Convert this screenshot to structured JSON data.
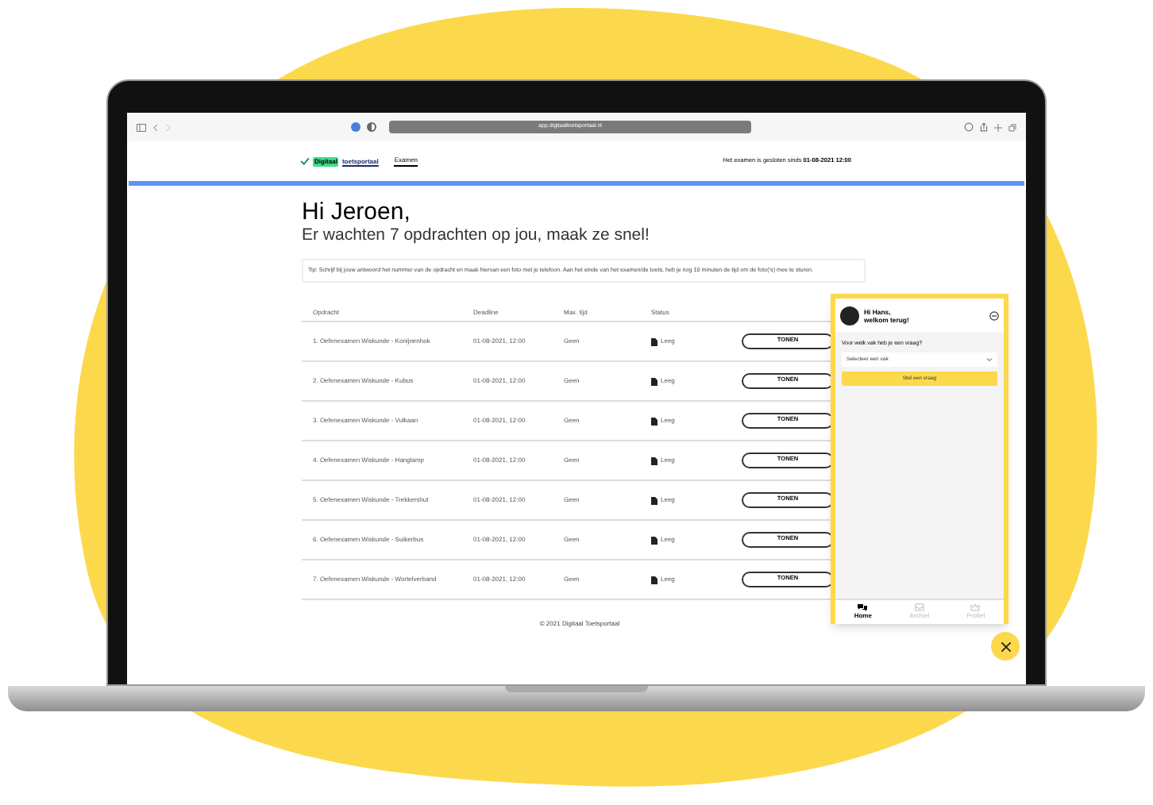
{
  "browser": {
    "url": "app.digitaaltoetsportaal.nl"
  },
  "header": {
    "logo_badge": "Digitaal",
    "logo_text": "toetsportaal",
    "nav": [
      {
        "label": "Examen",
        "selected": true
      }
    ],
    "notice": "Het examen is gesloten sinds",
    "notice_date": "01-08-2021 12:00"
  },
  "greeting": "Hi Jeroen,",
  "subtitle": "Er wachten 7 opdrachten op jou, maak ze snel!",
  "tip": "Tip: Schrijf bij jouw antwoord het nummer van de opdracht en maak hiervan een foto met je telefoon. Aan het einde van het examen/de toets, heb je nog 10 minuten de tijd om de foto('s) mee te sturen.",
  "table": {
    "columns": [
      "Opdracht",
      "Deadline",
      "Max. tijd",
      "Status"
    ],
    "rows": [
      {
        "task": "1. Oefenexamen Wiskunde - Konijnenhok",
        "deadline": "01-08-2021, 12:00",
        "max_time": "Geen",
        "status": "Leeg",
        "action": "TONEN"
      },
      {
        "task": "2. Oefenexamen Wiskunde - Kubus",
        "deadline": "01-08-2021, 12:00",
        "max_time": "Geen",
        "status": "Leeg",
        "action": "TONEN"
      },
      {
        "task": "3. Oefenexamen Wiskunde - Vulkaan",
        "deadline": "01-08-2021, 12:00",
        "max_time": "Geen",
        "status": "Leeg",
        "action": "TONEN"
      },
      {
        "task": "4. Oefenexamen Wiskunde - Hanglamp",
        "deadline": "01-08-2021, 12:00",
        "max_time": "Geen",
        "status": "Leeg",
        "action": "TONEN"
      },
      {
        "task": "5. Oefenexamen Wiskunde - Trekkershut",
        "deadline": "01-08-2021, 12:00",
        "max_time": "Geen",
        "status": "Leeg",
        "action": "TONEN"
      },
      {
        "task": "6. Oefenexamen Wiskunde - Suikerbus",
        "deadline": "01-08-2021, 12:00",
        "max_time": "Geen",
        "status": "Leeg",
        "action": "TONEN"
      },
      {
        "task": "7. Oefenexamen Wiskunde - Wortelverband",
        "deadline": "01-08-2021, 12:00",
        "max_time": "Geen",
        "status": "Leeg",
        "action": "TONEN"
      }
    ]
  },
  "footer": "© 2021 Digitaal Toetsportaal",
  "chat": {
    "greeting": "Hi Hans,",
    "greeting_line2": "welkom terug!",
    "question_label": "Voor welk vak heb je een vraag?",
    "select_placeholder": "Selecteer een vak",
    "submit": "Stel een vraag",
    "tabs": [
      {
        "label": "Home",
        "selected": true
      },
      {
        "label": "Archief",
        "selected": false
      },
      {
        "label": "Profiel",
        "selected": false
      }
    ]
  }
}
